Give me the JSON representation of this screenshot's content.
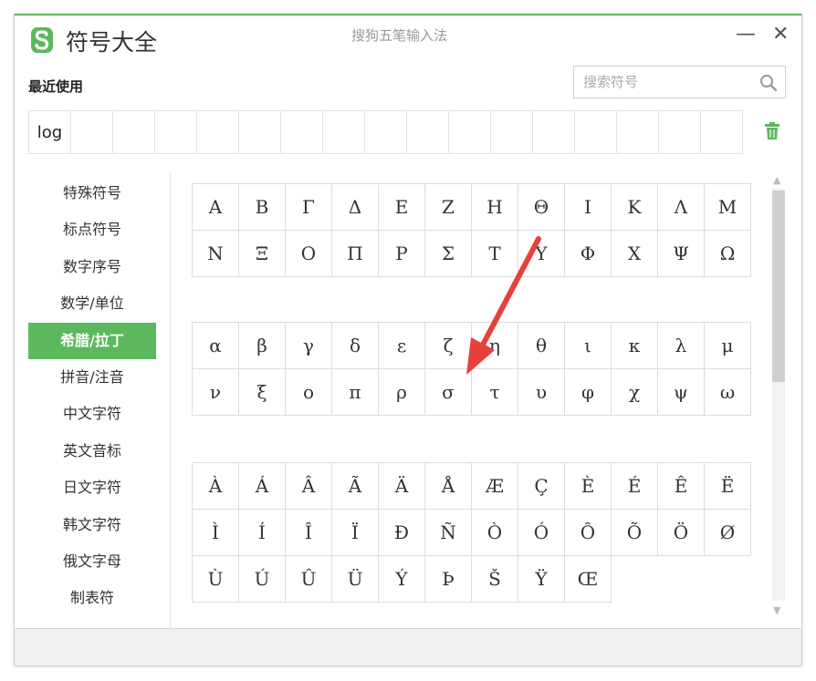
{
  "window": {
    "title": "符号大全",
    "center_title": "搜狗五笔输入法",
    "minimize_glyph": "—",
    "close_glyph": "✕",
    "accent": "#5cb85c"
  },
  "recent": {
    "label": "最近使用",
    "items": [
      "log",
      "",
      "",
      "",
      "",
      "",
      "",
      "",
      "",
      "",
      "",
      "",
      "",
      "",
      "",
      "",
      ""
    ]
  },
  "search": {
    "placeholder": "搜索符号",
    "value": ""
  },
  "sidebar": {
    "active_index": 4,
    "items": [
      {
        "label": "特殊符号"
      },
      {
        "label": "标点符号"
      },
      {
        "label": "数字序号"
      },
      {
        "label": "数学/单位"
      },
      {
        "label": "希腊/拉丁"
      },
      {
        "label": "拼音/注音"
      },
      {
        "label": "中文字符"
      },
      {
        "label": "英文音标"
      },
      {
        "label": "日文字符"
      },
      {
        "label": "韩文字符"
      },
      {
        "label": "俄文字母"
      },
      {
        "label": "制表符"
      }
    ]
  },
  "groups": [
    {
      "name": "greek-uppercase",
      "cells": [
        "Α",
        "Β",
        "Γ",
        "Δ",
        "Ε",
        "Ζ",
        "Η",
        "Θ",
        "Ι",
        "Κ",
        "Λ",
        "Μ",
        "Ν",
        "Ξ",
        "Ο",
        "Π",
        "Ρ",
        "Σ",
        "Τ",
        "Υ",
        "Φ",
        "Χ",
        "Ψ",
        "Ω"
      ]
    },
    {
      "name": "greek-lowercase",
      "cells": [
        "α",
        "β",
        "γ",
        "δ",
        "ε",
        "ζ",
        "η",
        "θ",
        "ι",
        "κ",
        "λ",
        "μ",
        "ν",
        "ξ",
        "ο",
        "π",
        "ρ",
        "σ",
        "τ",
        "υ",
        "φ",
        "χ",
        "ψ",
        "ω"
      ]
    },
    {
      "name": "latin-accented",
      "cells": [
        "À",
        "Á",
        "Â",
        "Ã",
        "Ä",
        "Å",
        "Æ",
        "Ç",
        "È",
        "É",
        "Ê",
        "Ë",
        "Ì",
        "Í",
        "Î",
        "Ï",
        "Ð",
        "Ñ",
        "Ò",
        "Ó",
        "Ô",
        "Õ",
        "Ö",
        "Ø",
        "Ù",
        "Ú",
        "Û",
        "Ü",
        "Ý",
        "Þ",
        "Š",
        "Ÿ",
        "Œ"
      ]
    }
  ],
  "annotation": {
    "arrow_color": "#e8413a"
  },
  "icons": {
    "logo": "sogou-s-logo-icon",
    "search": "magnifier-icon",
    "trash": "trash-icon"
  }
}
